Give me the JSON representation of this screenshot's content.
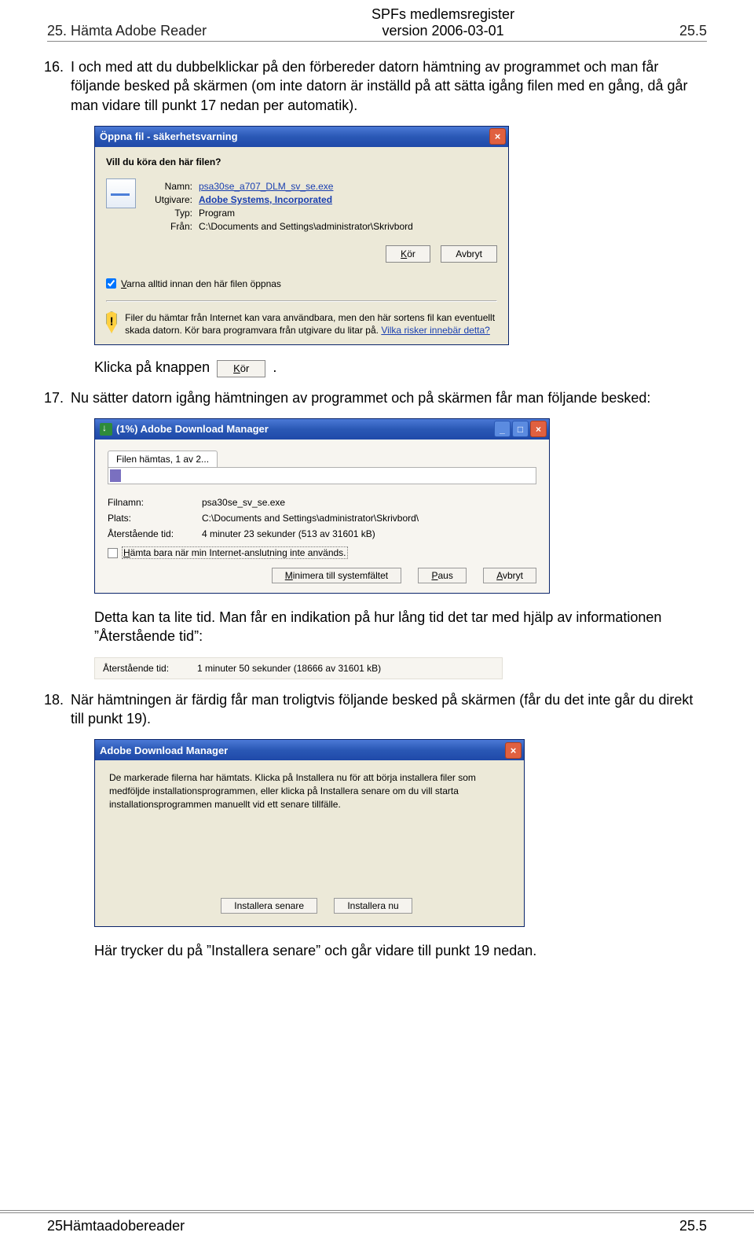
{
  "header": {
    "left": "25. Hämta Adobe Reader",
    "center1": "SPFs medlemsregister",
    "center2": "version 2006-03-01",
    "right": "25.5"
  },
  "p16": {
    "num": "16.",
    "text": "I och med att du dubbelklickar på den förbereder datorn hämtning av programmet och man får följande besked på skärmen (om inte datorn är inställd på att sätta igång filen med en gång, då går man vidare till punkt 17 nedan per automatik)."
  },
  "dlg1": {
    "title": "Öppna fil - säkerhetsvarning",
    "q": "Vill du köra den här filen?",
    "k_name": "Namn:",
    "v_name": "psa30se_a707_DLM_sv_se.exe",
    "k_pub": "Utgivare:",
    "v_pub": "Adobe Systems, Incorporated",
    "k_type": "Typ:",
    "v_type": "Program",
    "k_from": "Från:",
    "v_from": "C:\\Documents and Settings\\administrator\\Skrivbord",
    "btn_run": "Kör",
    "btn_cancel": "Avbryt",
    "chk": "Varna alltid innan den här filen öppnas",
    "warn": "Filer du hämtar från Internet kan vara användbara, men den här sortens fil kan eventuellt skada datorn. Kör bara programvara från utgivare du litar på. ",
    "warn_link": "Vilka risker innebär detta?"
  },
  "inline1": {
    "pre": "Klicka på knappen ",
    "btn": "Kör",
    "post": "."
  },
  "p17": {
    "num": "17.",
    "text": "Nu sätter datorn igång hämtningen av programmet och på skärmen får man följande besked:"
  },
  "dlg2": {
    "title": "(1%) Adobe Download Manager",
    "tab": "Filen hämtas, 1 av 2...",
    "k_file": "Filnamn:",
    "v_file": "psa30se_sv_se.exe",
    "k_loc": "Plats:",
    "v_loc": "C:\\Documents and Settings\\administrator\\Skrivbord\\",
    "k_rem": "Återstående tid:",
    "v_rem": "4 minuter 23 sekunder (513 av 31601 kB)",
    "chk": "Hämta bara när min Internet-anslutning inte används.",
    "btn_min": "Minimera till systemfältet",
    "btn_pause": "Paus",
    "btn_abort": "Avbryt"
  },
  "p17b": "Detta kan ta lite tid. Man får en indikation på hur lång tid det tar med hjälp av informationen ”Återstående tid”:",
  "snippet": {
    "k": "Återstående tid:",
    "v": "1 minuter 50 sekunder (18666 av 31601 kB)"
  },
  "p18": {
    "num": "18.",
    "text": "När hämtningen är färdig får man troligtvis följande besked på skärmen (får du det inte går du direkt till punkt 19)."
  },
  "dlg3": {
    "title": "Adobe Download Manager",
    "msg": "De markerade filerna har hämtats. Klicka på Installera nu för att börja installera filer som medföljde installationsprogrammen, eller klicka på Installera senare om du vill starta installationsprogrammen manuellt vid ett senare tillfälle.",
    "btn_later": "Installera senare",
    "btn_now": "Installera nu"
  },
  "p_end": "Här trycker du på ”Installera senare” och går vidare till punkt 19 nedan.",
  "footer": {
    "left": "25Hämtaadobereader",
    "right": "25.5"
  }
}
